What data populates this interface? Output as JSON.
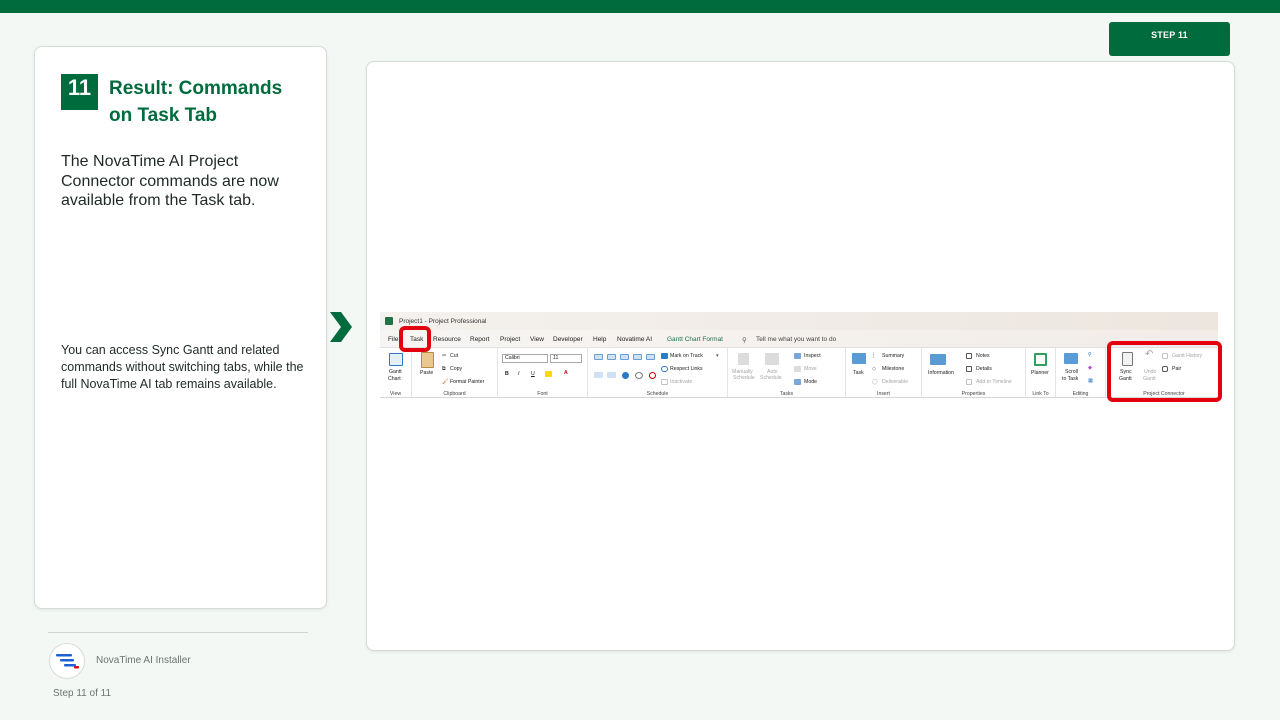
{
  "step_badge": "STEP 11",
  "step_number": "11",
  "card": {
    "title": "Result: Commands on Task Tab",
    "description": "The NovaTime AI Project Connector commands are now available from the Task tab.",
    "note": "You can access Sync Gantt and related commands without switching tabs, while the full NovaTime AI tab remains available."
  },
  "footer": {
    "app_name": "NovaTime AI Installer",
    "step_progress": "Step 11 of 11"
  },
  "ribbon": {
    "window_title": "Project1  -  Project Professional",
    "tabs": {
      "file": "File",
      "task": "Task",
      "resource": "Resource",
      "report": "Report",
      "project": "Project",
      "view": "View",
      "developer": "Developer",
      "help": "Help",
      "novatime": "Novatime AI",
      "gantt_format": "Gantt Chart Format",
      "tell_me": "Tell me what you want to do"
    },
    "groups": {
      "view": {
        "label": "View",
        "gantt_chart_1": "Gantt",
        "gantt_chart_2": "Chart"
      },
      "clipboard": {
        "label": "Clipboard",
        "paste": "Paste",
        "cut": "Cut",
        "copy": "Copy",
        "format_painter": "Format Painter"
      },
      "font": {
        "label": "Font",
        "font_name": "Calibri",
        "font_size": "11",
        "bold": "B",
        "italic": "I",
        "underline": "U",
        "font_color": "A"
      },
      "schedule": {
        "label": "Schedule",
        "mark_on_track": "Mark on Track",
        "respect_links": "Respect Links",
        "inactivate": "Inactivate"
      },
      "tasks": {
        "label": "Tasks",
        "manually_1": "Manually",
        "manually_2": "Schedule",
        "auto_1": "Auto",
        "auto_2": "Schedule",
        "inspect": "Inspect",
        "move": "Move",
        "mode": "Mode"
      },
      "insert": {
        "label": "Insert",
        "task": "Task",
        "summary": "Summary",
        "milestone": "Milestone",
        "deliverable": "Deliverable"
      },
      "properties": {
        "label": "Properties",
        "information": "Information",
        "notes": "Notes",
        "details": "Details",
        "add_to_timeline": "Add to Timeline"
      },
      "link_to": {
        "label": "Link To",
        "planner": "Planner"
      },
      "editing": {
        "label": "Editing",
        "scroll_1": "Scroll",
        "scroll_2": "to Task"
      },
      "project_connector": {
        "label": "Project Connector",
        "sync_1": "Sync",
        "sync_2": "Gantt",
        "undo_1": "Undo",
        "undo_2": "Gantt",
        "gantt_history": "Gantt History",
        "pair": "Pair"
      }
    }
  },
  "colors": {
    "brand_green": "#006b3c",
    "highlight_red": "#e3000f",
    "background": "#f3f8f4"
  }
}
